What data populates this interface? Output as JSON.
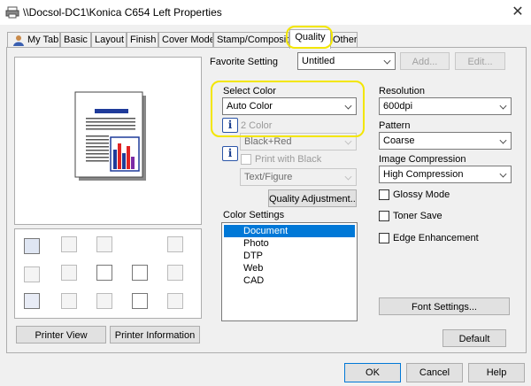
{
  "window": {
    "title": "\\\\Docsol-DC1\\Konica C654 Left Properties",
    "close_glyph": "✕"
  },
  "tabs": [
    {
      "label": "My Tab"
    },
    {
      "label": "Basic"
    },
    {
      "label": "Layout"
    },
    {
      "label": "Finish"
    },
    {
      "label": "Cover Mode"
    },
    {
      "label": "Stamp/Composition"
    },
    {
      "label": "Quality",
      "active": true
    },
    {
      "label": "Other"
    }
  ],
  "favorite": {
    "label": "Favorite Setting",
    "value": "Untitled",
    "add_label": "Add...",
    "edit_label": "Edit..."
  },
  "preview": {
    "buttons": {
      "printer_view": "Printer View",
      "printer_info": "Printer Information"
    }
  },
  "color": {
    "select_label": "Select Color",
    "select_value": "Auto Color",
    "two_color_label": "2 Color",
    "two_color_value": "Black+Red",
    "print_with_black_label": "Print with Black",
    "text_figure_value": "Text/Figure",
    "quality_adjust_label": "Quality Adjustment...",
    "settings_label": "Color Settings",
    "settings_items": [
      "Document",
      "Photo",
      "DTP",
      "Web",
      "CAD"
    ],
    "info_glyph": "i"
  },
  "right": {
    "resolution_label": "Resolution",
    "resolution_value": "600dpi",
    "pattern_label": "Pattern",
    "pattern_value": "Coarse",
    "compression_label": "Image Compression",
    "compression_value": "High Compression",
    "glossy_label": "Glossy Mode",
    "toner_save_label": "Toner Save",
    "edge_label": "Edge Enhancement",
    "font_settings_label": "Font Settings...",
    "default_label": "Default"
  },
  "footer": {
    "ok": "OK",
    "cancel": "Cancel",
    "help": "Help"
  },
  "colors": {
    "highlight": "#f3e600",
    "selection": "#0078d7",
    "accent_blue": "#1f3b9a"
  }
}
